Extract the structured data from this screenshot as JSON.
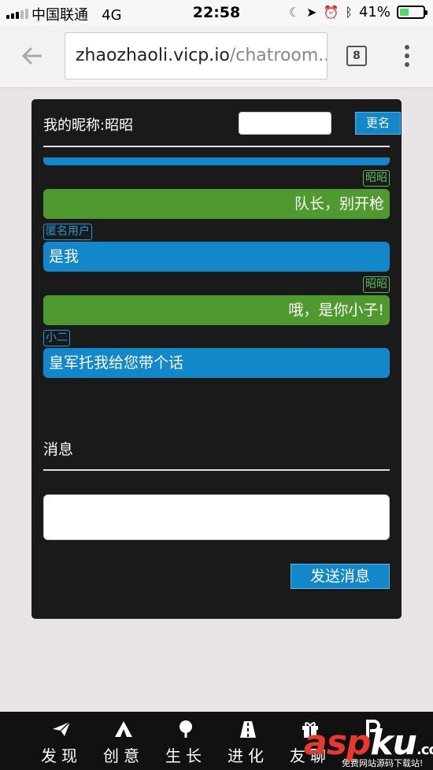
{
  "status_bar": {
    "carrier": "中国联通",
    "network": "4G",
    "time": "22:58",
    "battery_percent": "41%",
    "battery_level": 0.41
  },
  "browser": {
    "url_host": "zhaozhaoli.vicp.io",
    "url_path": "/chatroom...",
    "tab_count": "8"
  },
  "chat": {
    "nickname_label": "我的昵称:昭昭",
    "nickname_input_value": "",
    "rename_button": "更名",
    "messages": [
      {
        "sender": "昭昭",
        "text": "队长，别开枪",
        "side": "right",
        "color": "green"
      },
      {
        "sender": "匿名用户",
        "text": "是我",
        "side": "left",
        "color": "blue"
      },
      {
        "sender": "昭昭",
        "text": "哦，是你小子!",
        "side": "right",
        "color": "green"
      },
      {
        "sender": "小二",
        "text": "皇军托我给您带个话",
        "side": "left",
        "color": "blue"
      }
    ],
    "message_label": "消息",
    "message_input_value": "",
    "send_button": "发送消息"
  },
  "bottom_nav": {
    "items": [
      {
        "label": "发现",
        "icon": "paper-plane-icon"
      },
      {
        "label": "创意",
        "icon": "tent-icon"
      },
      {
        "label": "生长",
        "icon": "tree-icon"
      },
      {
        "label": "进化",
        "icon": "road-icon"
      },
      {
        "label": "友聊",
        "icon": "gift-icon"
      },
      {
        "label": "",
        "icon": "p-icon"
      }
    ]
  },
  "watermark": {
    "logo_a": "asp",
    "logo_b": "ku",
    "logo_suffix": ".com",
    "subtitle": "免费网站源码下载站!"
  },
  "colors": {
    "accent_blue": "#1287c9",
    "accent_green": "#4e9a2f",
    "panel_bg": "#1a1a1a",
    "page_bg": "#e9e4e8"
  }
}
